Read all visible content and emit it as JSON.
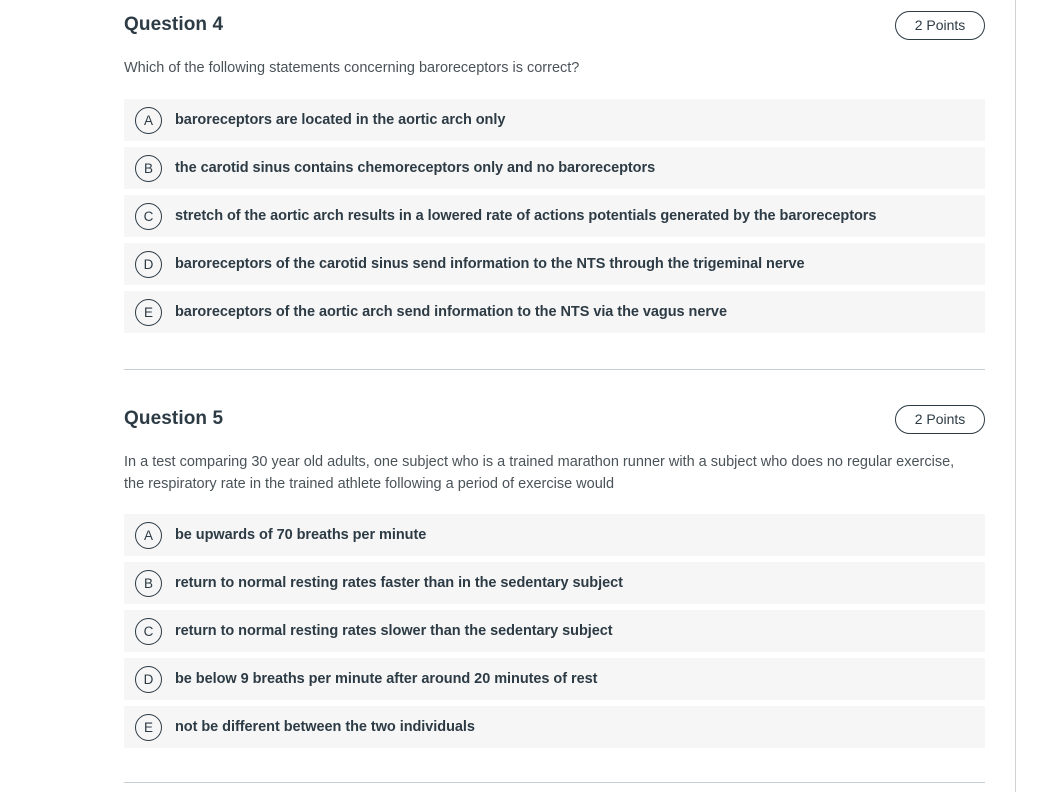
{
  "questions": [
    {
      "title": "Question 4",
      "points": "2 Points",
      "prompt": "Which of the following statements concerning baroreceptors is correct?",
      "options": [
        {
          "letter": "A",
          "text": "baroreceptors are located in the aortic arch only"
        },
        {
          "letter": "B",
          "text": "the carotid sinus contains chemoreceptors only and no baroreceptors"
        },
        {
          "letter": "C",
          "text": "stretch of the aortic arch results in a lowered rate of actions potentials generated by the baroreceptors"
        },
        {
          "letter": "D",
          "text": "baroreceptors of the carotid sinus send information to the NTS through the trigeminal nerve"
        },
        {
          "letter": "E",
          "text": "baroreceptors of the aortic arch send information to the NTS via the vagus nerve"
        }
      ]
    },
    {
      "title": "Question 5",
      "points": "2 Points",
      "prompt": "In a test comparing 30 year old adults, one subject who is a trained marathon runner with a subject who does no regular exercise, the respiratory rate in the trained athlete following a period of exercise would",
      "options": [
        {
          "letter": "A",
          "text": "be upwards of 70 breaths per minute"
        },
        {
          "letter": "B",
          "text": "return to normal resting rates faster than in the sedentary subject"
        },
        {
          "letter": "C",
          "text": "return to normal resting rates slower than the sedentary subject"
        },
        {
          "letter": "D",
          "text": "be below 9 breaths per minute after around 20 minutes of rest"
        },
        {
          "letter": "E",
          "text": "not be different between the two individuals"
        }
      ]
    }
  ],
  "colors": {
    "text": "#2d3b45",
    "prompt_text": "#4a5358",
    "option_bg": "#f6f6f6",
    "divider": "#c7cdd1",
    "page_bg": "#ffffff"
  }
}
